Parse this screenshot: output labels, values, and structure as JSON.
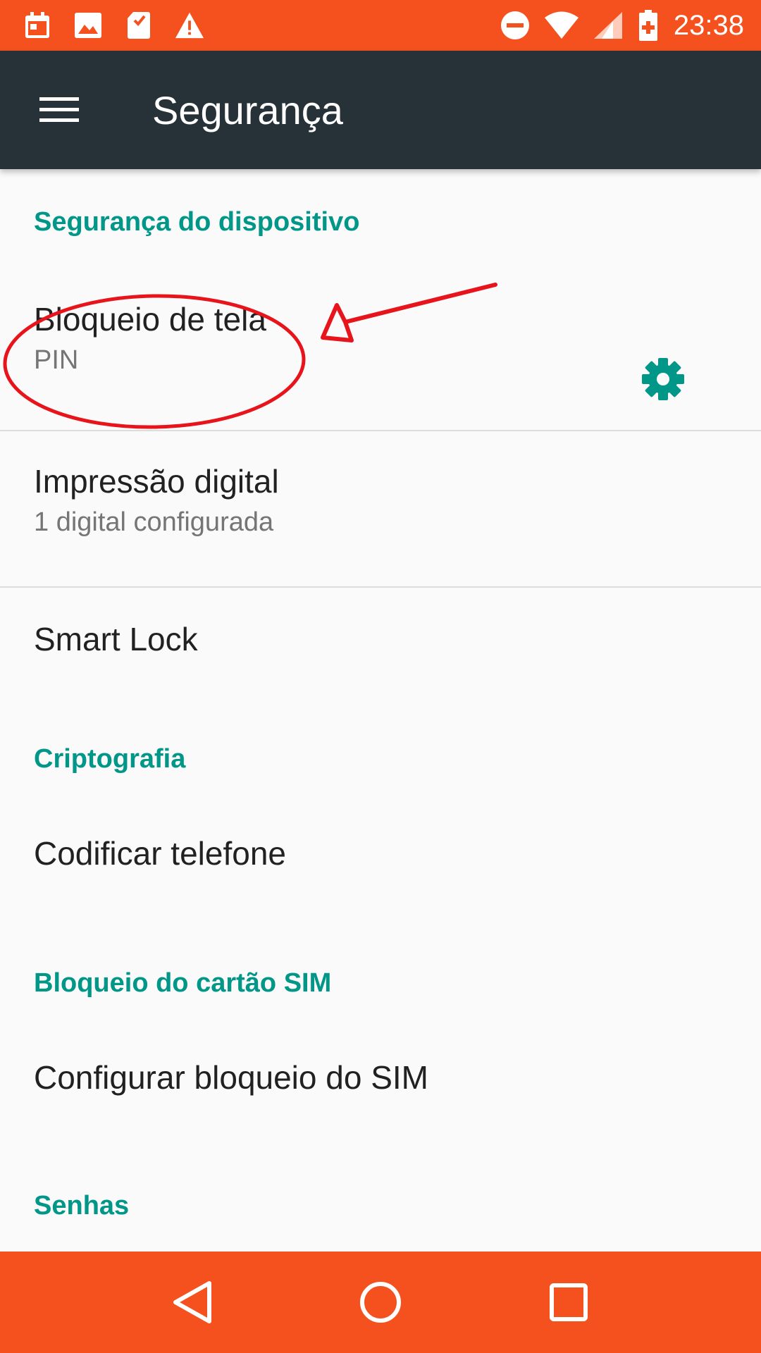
{
  "status_bar": {
    "time": "23:38",
    "color": "#f4511e",
    "left_icons": [
      "calendar-icon",
      "image-icon",
      "sd-card-icon",
      "warning-icon"
    ],
    "right_icons": [
      "do-not-disturb-icon",
      "wifi-icon",
      "signal-icon",
      "battery-charging-icon"
    ]
  },
  "toolbar": {
    "title": "Segurança",
    "color": "#263238"
  },
  "sections": {
    "device_security": {
      "header": "Segurança do dispositivo",
      "items": {
        "screen_lock": {
          "title": "Bloqueio de tela",
          "subtitle": "PIN"
        },
        "fingerprint": {
          "title": "Impressão digital",
          "subtitle": "1 digital configurada"
        },
        "smart_lock": {
          "title": "Smart Lock"
        }
      }
    },
    "encryption": {
      "header": "Criptografia",
      "items": {
        "encrypt_phone": {
          "title": "Codificar telefone"
        }
      }
    },
    "sim_lock": {
      "header": "Bloqueio do cartão SIM",
      "items": {
        "configure_sim_lock": {
          "title": "Configurar bloqueio do SIM"
        }
      }
    },
    "passwords": {
      "header": "Senhas"
    }
  },
  "accent_color": "#009688",
  "annotation_color": "#e8141b",
  "nav_bar": {
    "color": "#f4511e",
    "buttons": [
      "back-icon",
      "home-icon",
      "recents-icon"
    ]
  }
}
